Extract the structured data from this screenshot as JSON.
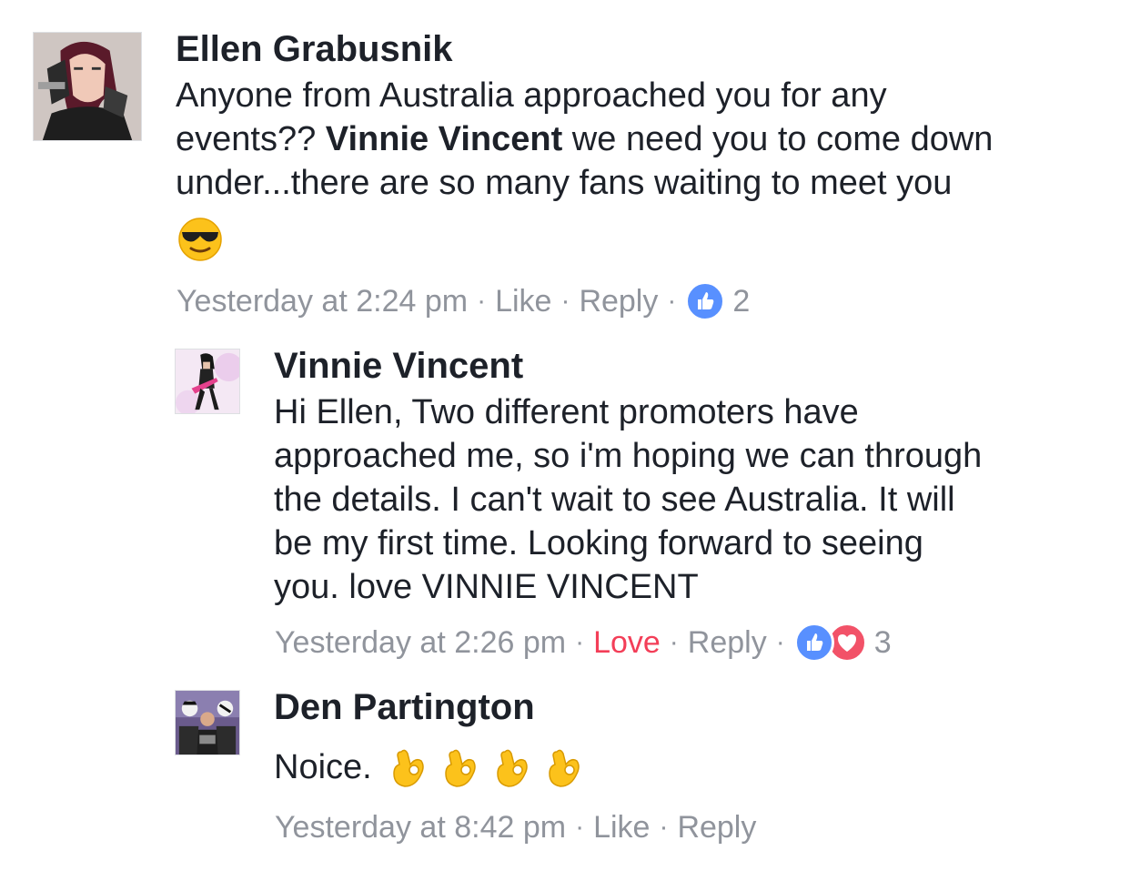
{
  "comments": [
    {
      "author": "Ellen Grabusnik",
      "text_lines": [
        "Anyone from Australia approached you for any",
        "under...there are so many fans waiting to meet you"
      ],
      "line2_before": "events?? ",
      "mention": "Vinnie Vincent",
      "line2_after": " we need you to come down",
      "emoji": "smiling-face-with-sunglasses",
      "timestamp": "Yesterday at 2:24 pm",
      "like_label": "Like",
      "reply_label": "Reply",
      "reaction_count": "2",
      "reactions": [
        "like-icon"
      ]
    },
    {
      "author": "Vinnie Vincent",
      "text_lines": [
        "Hi Ellen, Two different promoters have",
        "approached me, so i'm hoping we can through",
        "the details. I can't wait to see Australia. It will",
        "be my first time. Looking forward to seeing",
        "you. love VINNIE VINCENT"
      ],
      "timestamp": "Yesterday at 2:26 pm",
      "like_label": "Love",
      "reply_label": "Reply",
      "reaction_count": "3",
      "reactions": [
        "like-icon",
        "love-icon"
      ]
    },
    {
      "author": "Den Partington",
      "text": "Noice.",
      "emoji": "ok-hand x4",
      "timestamp": "Yesterday at 8:42 pm",
      "like_label": "Like",
      "reply_label": "Reply"
    }
  ],
  "colors": {
    "text": "#1d2129",
    "meta": "#90949c",
    "like_blue": "#5890ff",
    "love_red": "#f33e58"
  },
  "separator": "·"
}
